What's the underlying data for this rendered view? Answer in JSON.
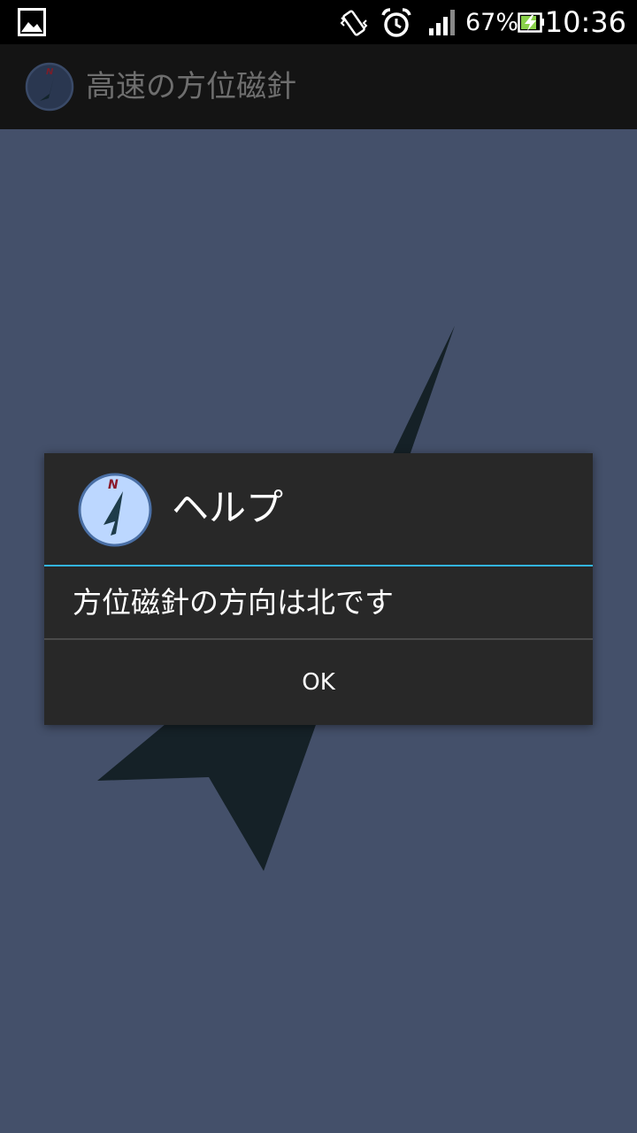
{
  "status_bar": {
    "battery_percent": "67%",
    "time": "10:36",
    "icons": [
      "gallery-icon",
      "vibrate-icon",
      "alarm-icon",
      "signal-icon",
      "battery-charging-icon"
    ]
  },
  "app_bar": {
    "title": "高速の方位磁針",
    "icon": "compass-icon",
    "title_color": "#6e6e6e"
  },
  "background": {
    "color": "#44506a",
    "needle_color": "#152127"
  },
  "dialog": {
    "icon": "compass-icon",
    "title": "ヘルプ",
    "message": "方位磁針の方向は北です",
    "ok_label": "OK",
    "accent_color": "#33b5e5",
    "background_color": "#282828"
  },
  "compass_icon": {
    "letter": "N",
    "ring_color": "#4a6fa5",
    "face_color": "#bcd7ff",
    "letter_color": "#8b1a2a",
    "needle_color": "#1e3c4a"
  }
}
